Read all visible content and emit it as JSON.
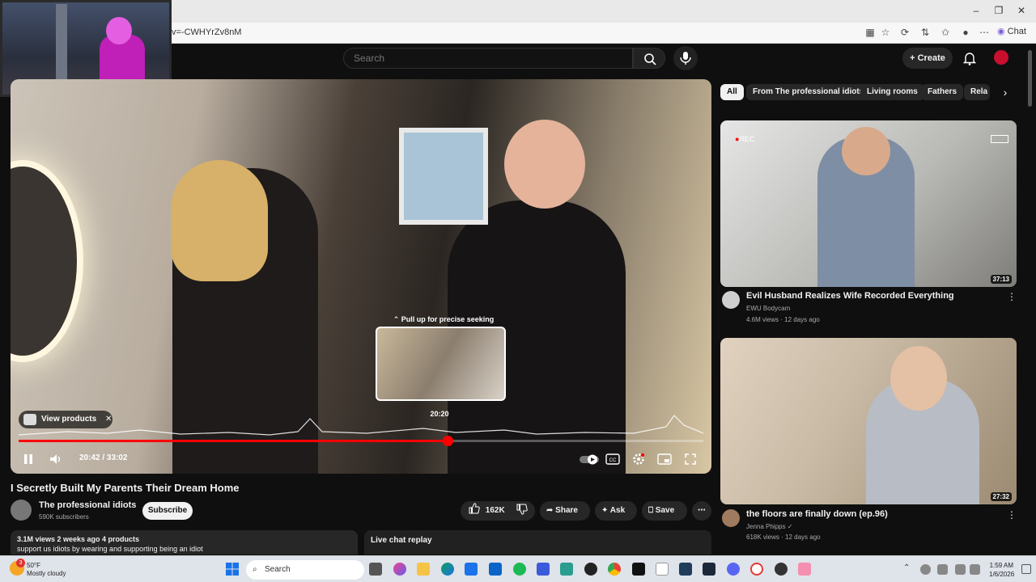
{
  "browser": {
    "url": "v=-CWHYrZv8nM",
    "chat_label": "Chat"
  },
  "header": {
    "search_placeholder": "Search",
    "create_label": "Create"
  },
  "player": {
    "preview_hint": "⌃ Pull up for precise seeking",
    "preview_time": "20:20",
    "view_products_label": "View products",
    "time_current": "20:42",
    "time_total": "33:02",
    "time_readout": "20:42 / 33:02",
    "progress_fraction": 0.627
  },
  "video": {
    "title": "I Secretly Built My Parents Their Dream Home",
    "channel_name": "The professional idiots",
    "subscribers": "590K subscribers",
    "subscribe_label": "Subscribe",
    "likes": "162K",
    "share_label": "Share",
    "ask_label": "Ask",
    "save_label": "Save",
    "stats": "3.1M views  2 weeks ago  4 products",
    "description_snippet": "support us idiots by wearing and supporting being an idiot",
    "live_chat_label": "Live chat replay"
  },
  "chips": [
    "All",
    "From The professional idiots",
    "Living rooms",
    "Fathers",
    "Rela"
  ],
  "recommendations": [
    {
      "title": "Evil Husband Realizes Wife Recorded Everything",
      "channel": "EWU Bodycam",
      "meta": "4.6M views · 12 days ago",
      "duration": "37:13",
      "rec_badge": "REC"
    },
    {
      "title": "the floors are finally down (ep.96)",
      "channel": "Jenna Phipps",
      "meta": "618K views · 12 days ago",
      "duration": "27:32"
    }
  ],
  "taskbar": {
    "notification_count": "3",
    "temperature": "50°F",
    "condition": "Mostly cloudy",
    "search_label": "Search",
    "time": "1:59 AM",
    "date": "1/6/2026"
  },
  "colors": {
    "yt_red": "#ff0000",
    "background": "#0f0f0f",
    "chip_active": "#f1f1f1"
  }
}
